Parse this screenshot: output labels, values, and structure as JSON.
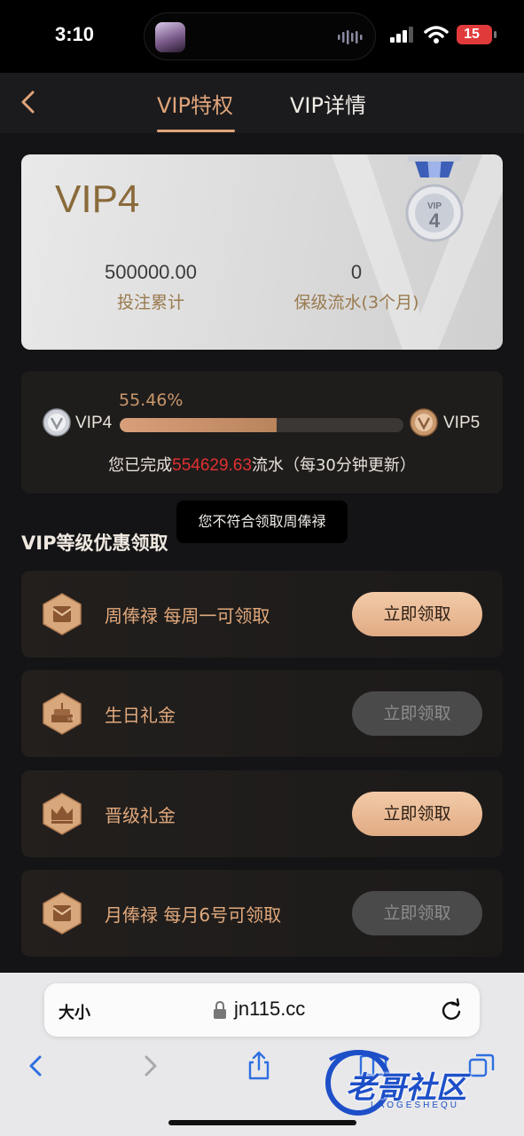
{
  "status_bar": {
    "time": "3:10",
    "battery": "15"
  },
  "nav": {
    "tabs": [
      {
        "label": "VIP特权",
        "active": true
      },
      {
        "label": "VIP详情",
        "active": false
      }
    ]
  },
  "vip_card": {
    "level": "VIP4",
    "medal_text": "VIP",
    "medal_number": "4",
    "stats": [
      {
        "value": "500000.00",
        "label": "投注累计"
      },
      {
        "value": "0",
        "label": "保级流水(3个月)"
      }
    ]
  },
  "progress": {
    "percent_text": "55.46%",
    "percent": 55.46,
    "current_level": "VIP4",
    "next_level": "VIP5",
    "done_prefix": "您已完成",
    "done_amount": "554629.63",
    "done_suffix": "流水（每30分钟更新）"
  },
  "tooltip": "您不符合领取周俸禄",
  "section_title": "VIP等级优惠领取",
  "benefits": [
    {
      "label": "周俸禄  每周一可领取",
      "button": "立即领取",
      "enabled": true,
      "icon": "envelope-icon"
    },
    {
      "label": "生日礼金",
      "button": "立即领取",
      "enabled": false,
      "icon": "cake-icon"
    },
    {
      "label": "晋级礼金",
      "button": "立即领取",
      "enabled": true,
      "icon": "crown-icon"
    },
    {
      "label": "月俸禄  每月6号可领取",
      "button": "立即领取",
      "enabled": false,
      "icon": "envelope-icon"
    }
  ],
  "browser": {
    "text_size": "大小",
    "url": "jn115.cc"
  },
  "watermark": {
    "text": "老哥社区",
    "sub": "LAOGESHEQU"
  },
  "colors": {
    "accent": "#e0a47a",
    "highlight_number": "#e03030",
    "button_enabled": "#e1ab84",
    "button_disabled": "#4a4a4b"
  }
}
